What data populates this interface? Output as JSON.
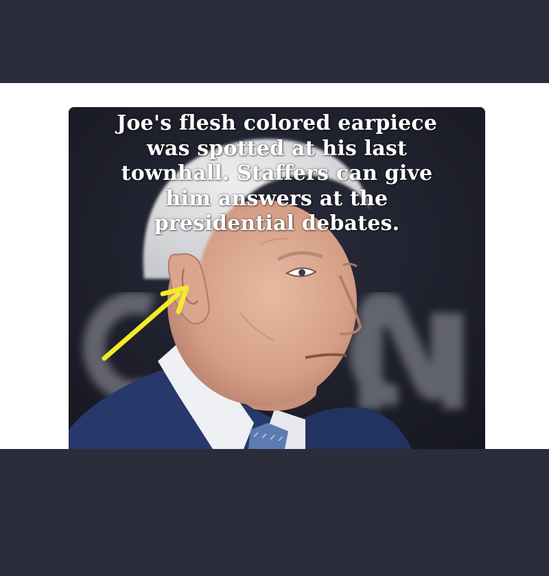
{
  "meme": {
    "caption_lines": [
      "Joe's flesh colored earpiece",
      "was spotted at his last",
      "townhall. Staffers can give",
      "him answers at the",
      "presidential debates."
    ],
    "background_logo_text": "CNN"
  },
  "colors": {
    "outer_background": "#2b2d3a",
    "middle_band": "#ffffff",
    "photo_background": "#1b1d2a",
    "caption_text": "#ffffff",
    "arrow": "#f5ea2a",
    "suit": "#27386a",
    "shirt": "#eef0f4",
    "logo_gray": "#6e707a"
  },
  "icons": {
    "annotation": "arrow-icon"
  }
}
